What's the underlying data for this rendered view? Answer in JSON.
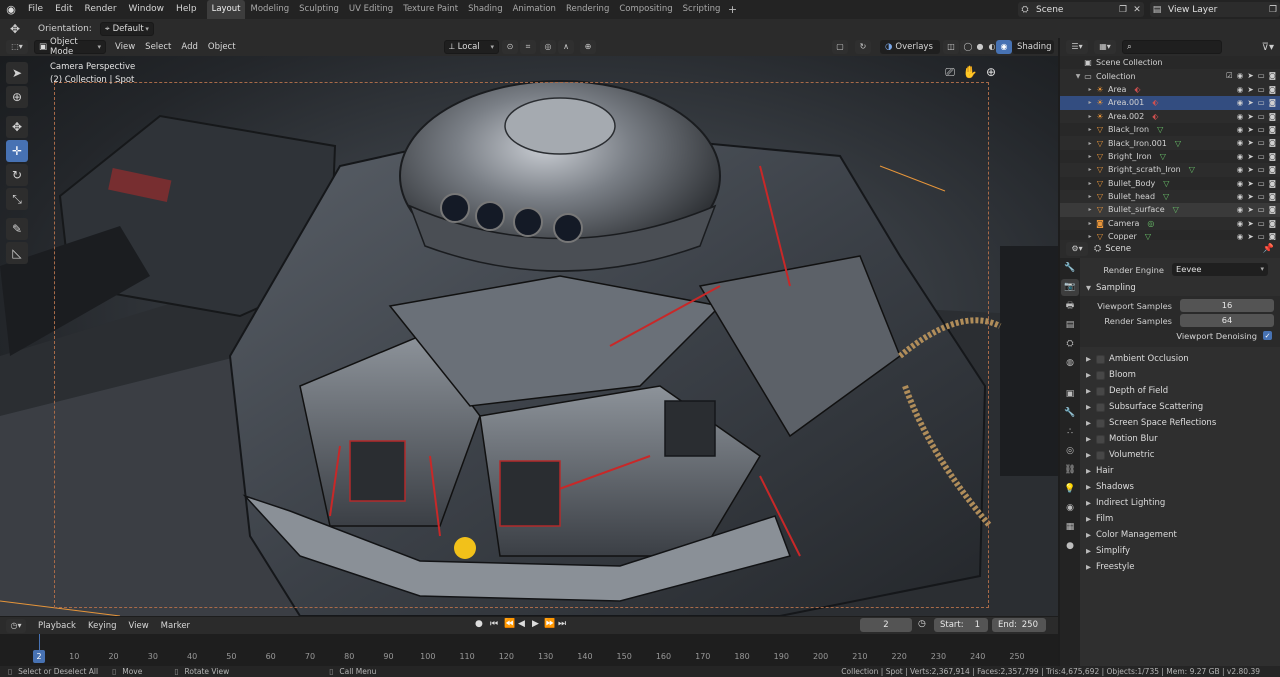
{
  "menu": {
    "items": [
      "File",
      "Edit",
      "Render",
      "Window",
      "Help"
    ],
    "workspaces": [
      "Layout",
      "Modeling",
      "Sculpting",
      "UV Editing",
      "Texture Paint",
      "Shading",
      "Animation",
      "Rendering",
      "Compositing",
      "Scripting"
    ],
    "active_workspace": "Layout",
    "add_workspace": "+",
    "scene_name": "Scene",
    "view_layer_name": "View Layer"
  },
  "tool_header": {
    "orientation_label": "Orientation:",
    "orientation_value": "Default"
  },
  "viewport_header": {
    "mode": "Object Mode",
    "menus": [
      "View",
      "Select",
      "Add",
      "Object"
    ],
    "transform_orientation": "Local",
    "overlays": "Overlays",
    "shading": "Shading"
  },
  "viewport": {
    "camera_label": "Camera Perspective",
    "collection_label": "(2) Collection | Spot"
  },
  "timeline": {
    "menus": [
      "Playback",
      "Keying",
      "View",
      "Marker"
    ],
    "current_frame": "2",
    "start_label": "Start:",
    "start_value": "1",
    "end_label": "End:",
    "end_value": "250",
    "ticks": [
      "0",
      "10",
      "20",
      "30",
      "40",
      "50",
      "60",
      "70",
      "80",
      "90",
      "100",
      "110",
      "120",
      "130",
      "140",
      "150",
      "160",
      "170",
      "180",
      "190",
      "200",
      "210",
      "220",
      "230",
      "240",
      "250"
    ],
    "cursor_label": "2"
  },
  "status": {
    "select": "Select or Deselect All",
    "move": "Move",
    "rotate": "Rotate View",
    "call_menu": "Call Menu",
    "stats": "Collection | Spot | Verts:2,367,914 | Faces:2,357,799 | Tris:4,675,692 | Objects:1/735 | Mem: 9.27 GB | v2.80.39"
  },
  "outliner": {
    "scene_collection": "Scene Collection",
    "collection": "Collection",
    "items": [
      {
        "name": "Area",
        "type": "light",
        "data_color": "#d05050"
      },
      {
        "name": "Area.001",
        "type": "light",
        "data_color": "#d05050",
        "selected": true
      },
      {
        "name": "Area.002",
        "type": "light",
        "data_color": "#d05050"
      },
      {
        "name": "Black_Iron",
        "type": "mesh",
        "data_color": "#6ac26a"
      },
      {
        "name": "Black_Iron.001",
        "type": "mesh",
        "data_color": "#6ac26a"
      },
      {
        "name": "Bright_Iron",
        "type": "mesh",
        "data_color": "#6ac26a"
      },
      {
        "name": "Bright_scrath_Iron",
        "type": "mesh",
        "data_color": "#6ac26a"
      },
      {
        "name": "Bullet_Body",
        "type": "mesh",
        "data_color": "#6ac26a"
      },
      {
        "name": "Bullet_head",
        "type": "mesh",
        "data_color": "#6ac26a"
      },
      {
        "name": "Bullet_surface",
        "type": "mesh",
        "data_color": "#6ac26a",
        "highlight": true
      },
      {
        "name": "Camera",
        "type": "camera",
        "data_color": "#6ac26a"
      },
      {
        "name": "Copper",
        "type": "mesh",
        "data_color": "#6ac26a"
      }
    ]
  },
  "properties": {
    "context": "Scene",
    "render_engine_label": "Render Engine",
    "render_engine_value": "Eevee",
    "sampling": {
      "title": "Sampling",
      "viewport_samples_label": "Viewport Samples",
      "viewport_samples_value": "16",
      "render_samples_label": "Render Samples",
      "render_samples_value": "64",
      "denoise_label": "Viewport Denoising"
    },
    "checkbox_panels": [
      "Ambient Occlusion",
      "Bloom",
      "Depth of Field",
      "Subsurface Scattering",
      "Screen Space Reflections",
      "Motion Blur",
      "Volumetric"
    ],
    "panels": [
      "Hair",
      "Shadows",
      "Indirect Lighting",
      "Film",
      "Color Management",
      "Simplify",
      "Freestyle"
    ]
  },
  "colors": {
    "accent": "#4772b3",
    "light_icon": "#e8953a",
    "mesh_icon": "#e8953a"
  }
}
